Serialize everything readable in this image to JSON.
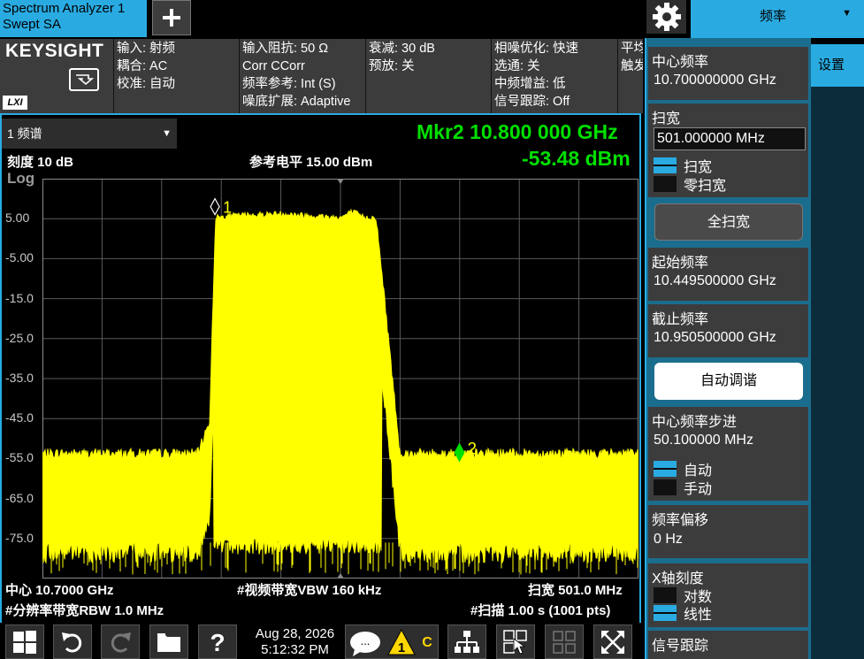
{
  "app": {
    "tab_title": "Spectrum Analyzer 1",
    "tab_subtitle": "Swept SA",
    "brand": "KEYSIGHT",
    "lxi": "LXI"
  },
  "menu": {
    "selected": "频率",
    "side_tab": "设置"
  },
  "header": {
    "col1": [
      "输入: 射频",
      "耦合: AC",
      "校准: 自动"
    ],
    "col2": [
      "输入阻抗: 50 Ω",
      "Corr CCorr",
      "频率参考: Int (S)",
      "噪底扩展: Adaptive"
    ],
    "col3": [
      "衰减: 30 dB",
      "预放: 关"
    ],
    "col4": [
      "相噪优化: 快速",
      "选通: 关",
      "中频增益: 低",
      "信号跟踪: Off"
    ],
    "col5": [
      "平均",
      "触发"
    ]
  },
  "trace_selector": "1 频谱",
  "display": {
    "scale": "刻度 10 dB",
    "ref_level": "参考电平 15.00 dBm",
    "log": "Log",
    "marker_freq": "Mkr2  10.800 000 GHz",
    "marker_amp": "-53.48 dBm",
    "center": "中心 10.7000 GHz",
    "vbw": "#视频带宽VBW 160 kHz",
    "span": "扫宽 501.0 MHz",
    "rbw": "#分辨率带宽RBW 1.0 MHz",
    "sweep": "#扫描 1.00 s (1001 pts)"
  },
  "chart_data": {
    "type": "line",
    "x_unit": "GHz",
    "y_unit": "dBm",
    "xlim": [
      10.4495,
      10.9505
    ],
    "ylim": [
      -85,
      15
    ],
    "y_ticks": [
      "5.00",
      "-5.00",
      "-15.0",
      "-25.0",
      "-35.0",
      "-45.0",
      "-55.0",
      "-65.0",
      "-75.0"
    ],
    "grid": true,
    "series": [
      {
        "x": [
          10.4495,
          10.5,
          10.58,
          10.59,
          10.595,
          10.61,
          10.65,
          10.7,
          10.71,
          10.72,
          10.73,
          10.75,
          10.8,
          10.85,
          10.9,
          10.9505
        ],
        "y": [
          -55,
          -55,
          -55,
          -47,
          4.5,
          5,
          5.5,
          4.5,
          6,
          4.5,
          4.5,
          -55,
          -55,
          -55,
          -55,
          -55
        ]
      }
    ],
    "markers": [
      {
        "label": "1",
        "x": 10.5945,
        "y": 8
      },
      {
        "label": "2",
        "x": 10.8,
        "y": -53.48
      }
    ]
  },
  "taskbar": {
    "date": "Aug 28, 2026",
    "time": "5:12:32 PM",
    "alert_count": "1",
    "alert_flag": "C",
    "chat": "..."
  },
  "softkeys": {
    "center": {
      "title": "中心频率",
      "value": "10.700000000 GHz"
    },
    "span": {
      "title": "扫宽",
      "value": "501.000000 MHz",
      "opt_on": "扫宽",
      "opt_off": "零扫宽"
    },
    "full_span": "全扫宽",
    "start": {
      "title": "起始频率",
      "value": "10.449500000 GHz"
    },
    "stop": {
      "title": "截止频率",
      "value": "10.950500000 GHz"
    },
    "auto_tune": "自动调谐",
    "cf_step": {
      "title": "中心频率步进",
      "value": "50.100000 MHz",
      "opt_on": "自动",
      "opt_off": "手动"
    },
    "offset": {
      "title": "频率偏移",
      "value": "0 Hz"
    },
    "xscale": {
      "title": "X轴刻度",
      "opt_off": "对数",
      "opt_on": "线性"
    },
    "tracking": {
      "title": "信号跟踪"
    }
  },
  "colors": {
    "accent": "#29abe2",
    "trace": "#ffff00",
    "marker": "#00e000"
  }
}
